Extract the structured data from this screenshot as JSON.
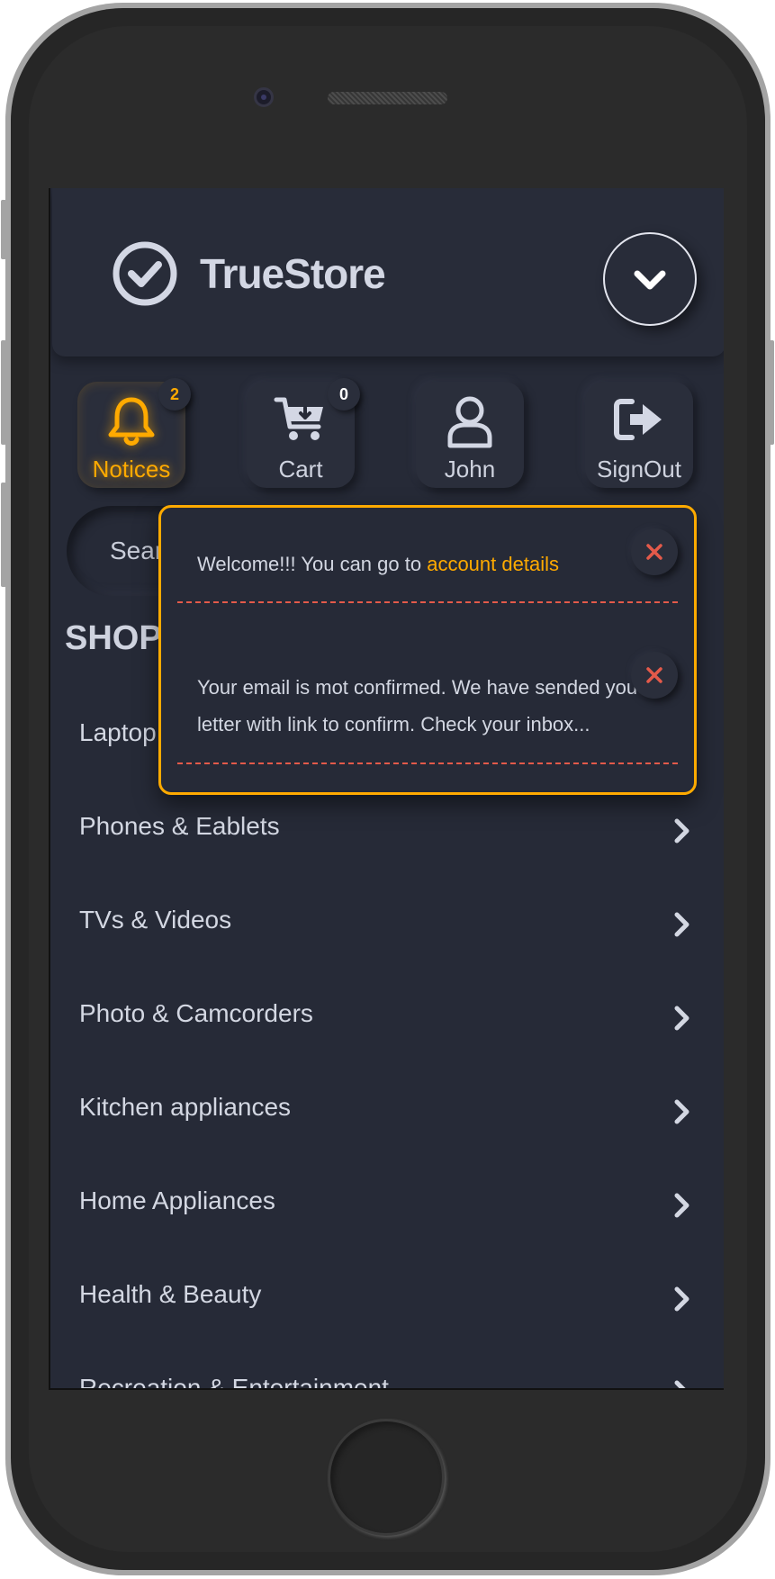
{
  "app": {
    "brand": "TrueStore"
  },
  "nav": {
    "notices": {
      "label": "Notices",
      "badge": "2"
    },
    "cart": {
      "label": "Cart",
      "badge": "0"
    },
    "user": {
      "label": "John"
    },
    "signout": {
      "label": "SignOut"
    }
  },
  "search": {
    "placeholder": "Sear"
  },
  "shop": {
    "title": "SHOP",
    "categories": [
      {
        "label": "Laptop"
      },
      {
        "label": "Phones & Eablets"
      },
      {
        "label": "TVs & Videos"
      },
      {
        "label": "Photo & Camcorders"
      },
      {
        "label": "Kitchen appliances"
      },
      {
        "label": "Home Appliances"
      },
      {
        "label": "Health & Beauty"
      },
      {
        "label": "Recreation & Entertainment"
      }
    ]
  },
  "notifications": {
    "items": [
      {
        "text": "Welcome!!! You can go to ",
        "link": "account details"
      },
      {
        "text": "Your email is mot confirmed. We have sended you letter with link to confirm. Check your inbox..."
      }
    ]
  },
  "colors": {
    "accent": "#ffaa00",
    "background": "#262a37",
    "danger": "#e45a4a"
  },
  "icons": [
    "check-circle-icon",
    "chevron-down-icon",
    "bell-icon",
    "cart-icon",
    "user-icon",
    "sign-out-icon",
    "list-icon",
    "chevron-right-icon",
    "close-icon"
  ]
}
